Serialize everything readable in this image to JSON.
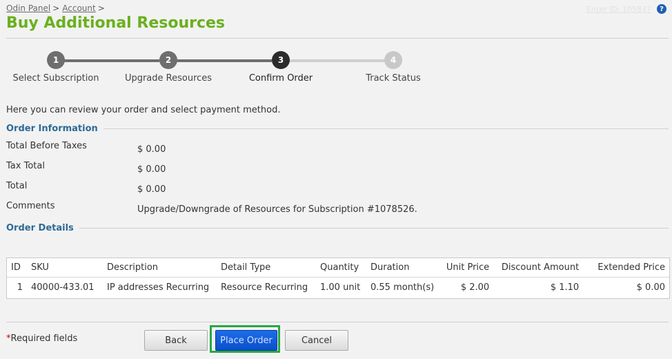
{
  "breadcrumb": {
    "items": [
      "Odin Panel",
      "Account"
    ],
    "sep": ">"
  },
  "top_right": {
    "faint_text": "Enter ID: 105837",
    "help_symbol": "?"
  },
  "title": "Buy Additional Resources",
  "wizard": {
    "steps": [
      {
        "num": "1",
        "label": "Select Subscription",
        "state": "done"
      },
      {
        "num": "2",
        "label": "Upgrade Resources",
        "state": "done"
      },
      {
        "num": "3",
        "label": "Confirm Order",
        "state": "current"
      },
      {
        "num": "4",
        "label": "Track Status",
        "state": "pending"
      }
    ]
  },
  "intro": "Here you can review your order and select payment method.",
  "order_info": {
    "heading": "Order Information",
    "rows": [
      {
        "label": "Total Before Taxes",
        "value": "$ 0.00"
      },
      {
        "label": "Tax Total",
        "value": "$ 0.00"
      },
      {
        "label": "Total",
        "value": "$ 0.00"
      },
      {
        "label": "Comments",
        "value": "Upgrade/Downgrade of Resources for Subscription #1078526."
      }
    ]
  },
  "order_details": {
    "heading": "Order Details",
    "columns": [
      "ID",
      "SKU",
      "Description",
      "Detail Type",
      "Quantity",
      "Duration",
      "Unit Price",
      "Discount Amount",
      "Extended Price"
    ],
    "rows": [
      [
        "1",
        "40000-433.01",
        "IP addresses Recurring",
        "Resource Recurring",
        "1.00 unit",
        "0.55 month(s)",
        "$ 2.00",
        "$ 1.10",
        "$ 0.00"
      ]
    ]
  },
  "footer": {
    "required_star": "*",
    "required_text": "Required fields",
    "back_label": "Back",
    "place_order_label": "Place Order",
    "cancel_label": "Cancel"
  },
  "colors": {
    "title_green": "#6ab01d",
    "section_blue": "#2e6a95",
    "primary_button": "#1d6de8",
    "highlight_green": "#27a844",
    "step_done": "#6e6e6e",
    "step_current": "#2b2b2b",
    "step_pending": "#c8c8c8"
  }
}
